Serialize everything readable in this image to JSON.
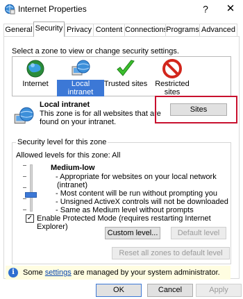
{
  "window": {
    "title": "Internet Properties",
    "help_glyph": "?",
    "close_glyph": "✕"
  },
  "tabs": [
    {
      "label": "General"
    },
    {
      "label": "Security"
    },
    {
      "label": "Privacy"
    },
    {
      "label": "Content"
    },
    {
      "label": "Connections"
    },
    {
      "label": "Programs"
    },
    {
      "label": "Advanced"
    }
  ],
  "active_tab": "Security",
  "security": {
    "zone_instruction": "Select a zone to view or change security settings.",
    "zones": [
      {
        "label": "Internet",
        "icon": "globe-icon"
      },
      {
        "label": "Local intranet",
        "icon": "intranet-icon"
      },
      {
        "label": "Trusted sites",
        "icon": "checkmark-icon"
      },
      {
        "label": "Restricted sites",
        "icon": "restricted-icon"
      }
    ],
    "selected_zone": "Local intranet",
    "zone_detail": {
      "title": "Local intranet",
      "description": "This zone is for all websites that are found on your intranet.",
      "sites_button": "Sites"
    },
    "level_group": {
      "legend": "Security level for this zone",
      "allowed_levels": "Allowed levels for this zone: All",
      "slider_level_fraction": 0.25,
      "level_name": "Medium-low",
      "level_description": [
        "- Appropriate for websites on your local network",
        "(intranet)",
        "- Most content will be run without prompting you",
        "- Unsigned ActiveX controls will not be downloaded",
        "- Same as Medium level without prompts"
      ],
      "protected_mode_label": "Enable Protected Mode (requires restarting Internet Explorer)",
      "protected_mode_checked": true,
      "check_glyph": "✓",
      "custom_level_button": "Custom level...",
      "default_level_button": "Default level",
      "reset_all_button": "Reset all zones to default level"
    },
    "info_bar": {
      "prefix": "Some ",
      "link": "settings",
      "suffix": " are managed by your system administrator.",
      "icon_glyph": "i"
    }
  },
  "footer": {
    "ok": "OK",
    "cancel": "Cancel",
    "apply": "Apply"
  },
  "colors": {
    "selection": "#3c78d6",
    "highlight_box": "#c8102e",
    "info_bar_bg": "#fffde1"
  }
}
